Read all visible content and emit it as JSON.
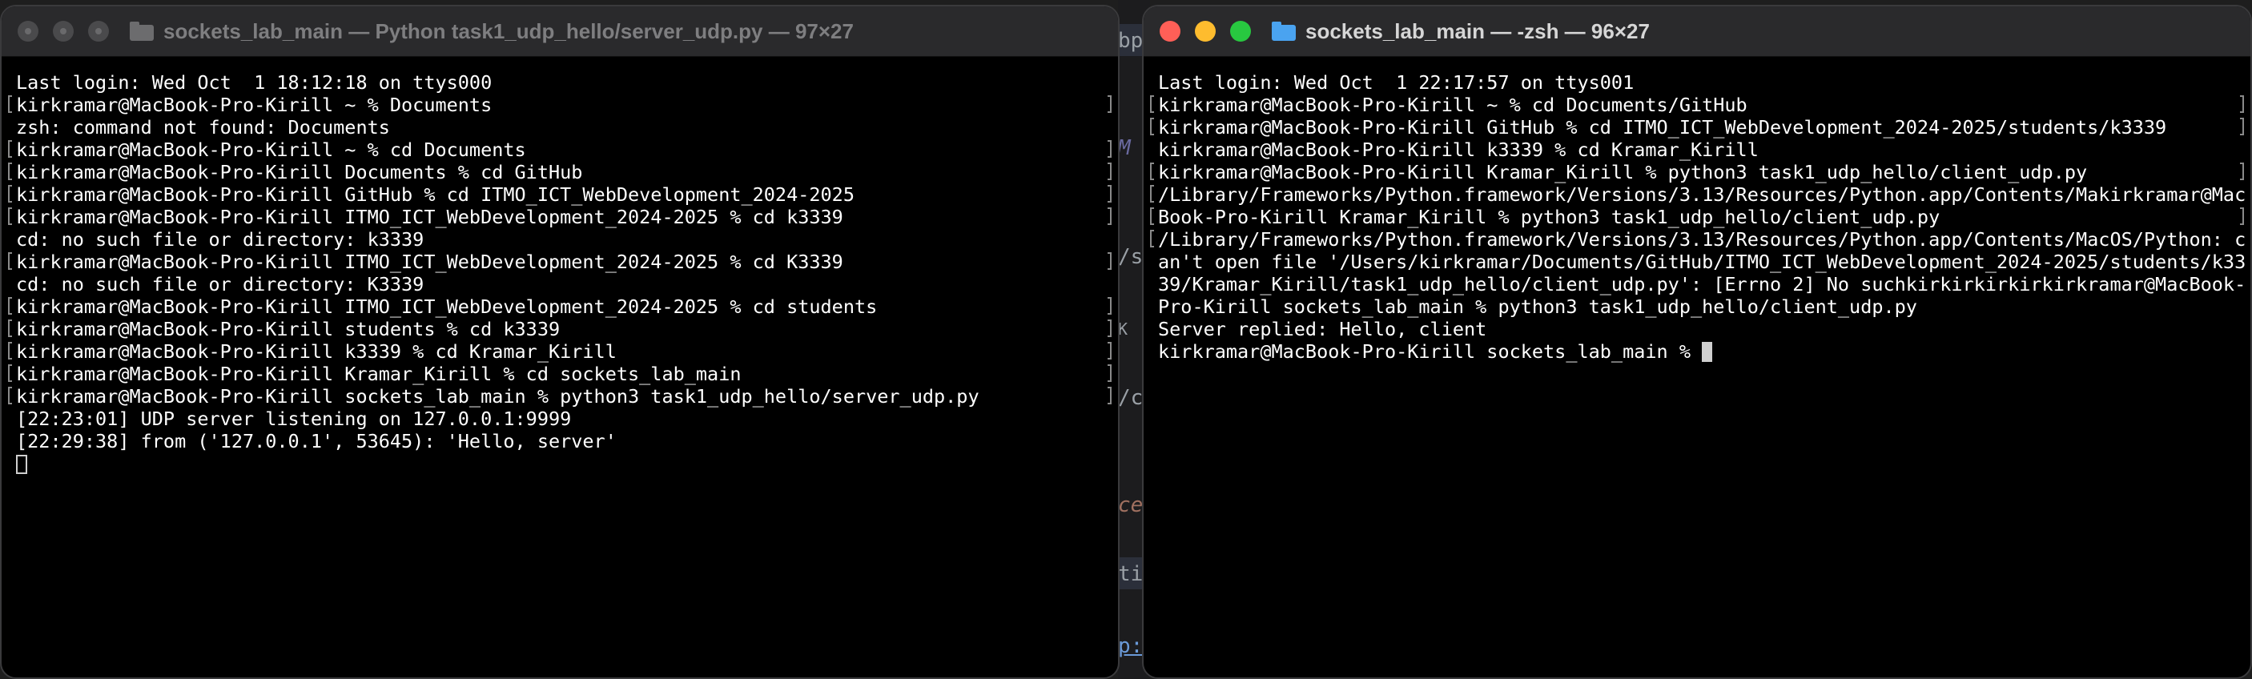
{
  "background_editor": {
    "fragments": [
      "bp/",
      "M",
      "/s",
      "K",
      "/c",
      "ce",
      "ti",
      "p:"
    ],
    "colors": [
      "#9aa0a6",
      "#6a6aa0",
      "#9aa0a6",
      "#9aa0a6",
      "#9aa0a6",
      "#a07060",
      "#9aa0a6",
      "#6a9ad8"
    ]
  },
  "left_window": {
    "state": "inactive",
    "title": "sockets_lab_main — Python task1_udp_hello/server_udp.py — 97×27",
    "lines": [
      "Last login: Wed Oct  1 18:12:18 on ttys000",
      "kirkramar@MacBook-Pro-Kirill ~ % Documents",
      "zsh: command not found: Documents",
      "kirkramar@MacBook-Pro-Kirill ~ % cd Documents",
      "kirkramar@MacBook-Pro-Kirill Documents % cd GitHub",
      "kirkramar@MacBook-Pro-Kirill GitHub % cd ITMO_ICT_WebDevelopment_2024-2025",
      "kirkramar@MacBook-Pro-Kirill ITMO_ICT_WebDevelopment_2024-2025 % cd k3339",
      "cd: no such file or directory: k3339",
      "kirkramar@MacBook-Pro-Kirill ITMO_ICT_WebDevelopment_2024-2025 % cd K3339",
      "cd: no such file or directory: K3339",
      "kirkramar@MacBook-Pro-Kirill ITMO_ICT_WebDevelopment_2024-2025 % cd students",
      "kirkramar@MacBook-Pro-Kirill students % cd k3339",
      "kirkramar@MacBook-Pro-Kirill k3339 % cd Kramar_Kirill",
      "kirkramar@MacBook-Pro-Kirill Kramar_Kirill % cd sockets_lab_main",
      "kirkramar@MacBook-Pro-Kirill sockets_lab_main % python3 task1_udp_hello/server_udp.py",
      "[22:23:01] UDP server listening on 127.0.0.1:9999",
      "[22:29:38] from ('127.0.0.1', 53645): 'Hello, server'"
    ],
    "cursor_style": "hollow-box"
  },
  "right_window": {
    "state": "active",
    "title": "sockets_lab_main — -zsh — 96×27",
    "lines": [
      "Last login: Wed Oct  1 22:17:57 on ttys001",
      "kirkramar@MacBook-Pro-Kirill ~ % cd Documents/GitHub",
      "kirkramar@MacBook-Pro-Kirill GitHub % cd ITMO_ICT_WebDevelopment_2024-2025/students/k3339",
      "kirkramar@MacBook-Pro-Kirill k3339 % cd Kramar_Kirill",
      "kirkramar@MacBook-Pro-Kirill Kramar_Kirill % python3 task1_udp_hello/client_udp.py",
      "/Library/Frameworks/Python.framework/Versions/3.13/Resources/Python.app/Contents/Makirkramar@Mac",
      "Book-Pro-Kirill Kramar_Kirill % python3 task1_udp_hello/client_udp.py",
      "/Library/Frameworks/Python.framework/Versions/3.13/Resources/Python.app/Contents/MacOS/Python: c",
      "an't open file '/Users/kirkramar/Documents/GitHub/ITMO_ICT_WebDevelopment_2024-2025/students/k33",
      "39/Kramar_Kirill/task1_udp_hello/client_udp.py': [Errno 2] No suchkirkirkirkirkirkramar@MacBook-",
      "Pro-Kirill sockets_lab_main % python3 task1_udp_hello/client_udp.py",
      "Server replied: Hello, client",
      "kirkramar@MacBook-Pro-Kirill sockets_lab_main % "
    ],
    "cursor_style": "solid-block"
  }
}
